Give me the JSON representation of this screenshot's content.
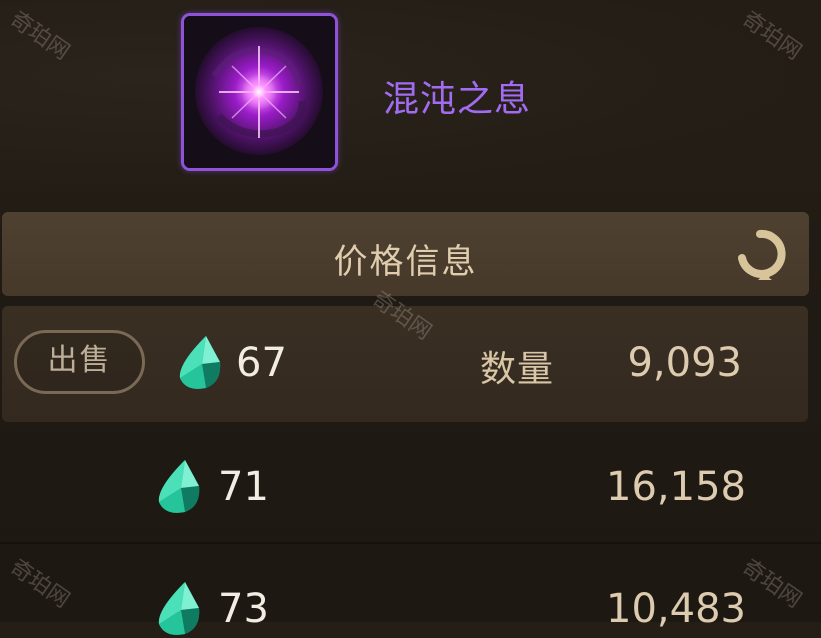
{
  "item": {
    "name": "混沌之息",
    "rarity_color": "#a26cf2",
    "icon": "chaos-breath-icon"
  },
  "price_panel": {
    "title": "价格信息",
    "refresh_icon": "refresh-icon"
  },
  "listings": [
    {
      "price": "67",
      "quantity_label": "数量",
      "quantity": "9,093",
      "action": "出售",
      "currency_icon": "gem-icon"
    },
    {
      "price": "71",
      "quantity": "16,158",
      "currency_icon": "gem-icon"
    },
    {
      "price": "73",
      "quantity": "10,483",
      "currency_icon": "gem-icon"
    }
  ],
  "watermark": "奇珀网",
  "colors": {
    "background": "#221c15",
    "header_bar": "#4b3d2d",
    "accent_purple": "#8e53d8",
    "gem_teal": "#2ec9a0"
  }
}
